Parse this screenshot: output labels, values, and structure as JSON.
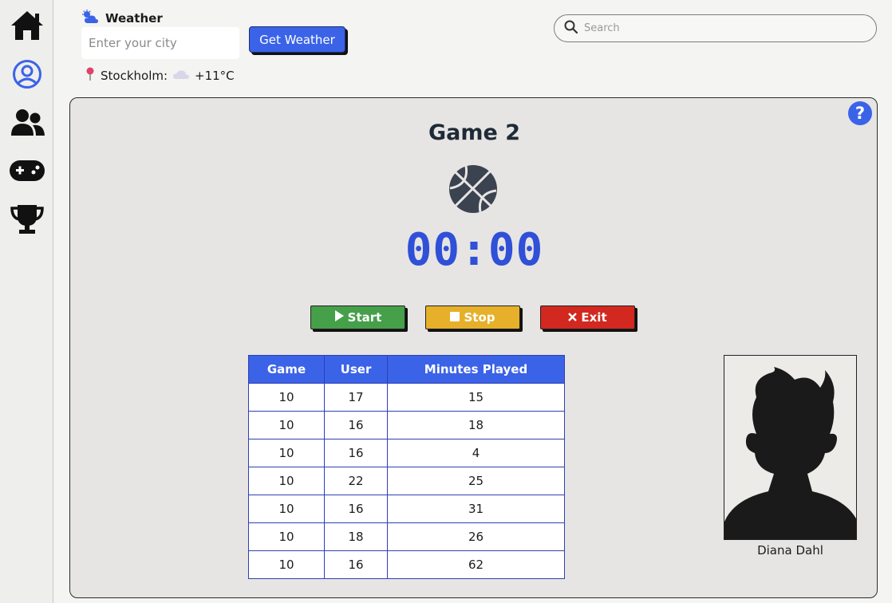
{
  "sidebar": {
    "items": [
      {
        "name": "home",
        "icon": "home-icon"
      },
      {
        "name": "profile",
        "icon": "user-circle-icon"
      },
      {
        "name": "users",
        "icon": "users-icon"
      },
      {
        "name": "games",
        "icon": "gamepad-icon"
      },
      {
        "name": "trophy",
        "icon": "trophy-icon"
      }
    ],
    "active_color": "#3b63e8"
  },
  "weather": {
    "title": "Weather",
    "input_placeholder": "Enter your city",
    "button_label": "Get Weather",
    "city": "Stockholm:",
    "temperature": "+11°C"
  },
  "search": {
    "placeholder": "Search"
  },
  "game": {
    "title": "Game 2",
    "timer": "00:00",
    "buttons": {
      "start": "Start",
      "stop": "Stop",
      "exit": "Exit"
    },
    "help_label": "?"
  },
  "table": {
    "headers": [
      "Game",
      "User",
      "Minutes Played"
    ],
    "rows": [
      [
        "10",
        "17",
        "15"
      ],
      [
        "10",
        "16",
        "18"
      ],
      [
        "10",
        "16",
        "4"
      ],
      [
        "10",
        "22",
        "25"
      ],
      [
        "10",
        "16",
        "31"
      ],
      [
        "10",
        "18",
        "26"
      ],
      [
        "10",
        "16",
        "62"
      ]
    ]
  },
  "player": {
    "name": "Diana Dahl"
  },
  "colors": {
    "accent": "#3b63e8",
    "start": "#45a049",
    "stop": "#e6b02a",
    "exit": "#d2281f",
    "timer": "#3050d8"
  }
}
